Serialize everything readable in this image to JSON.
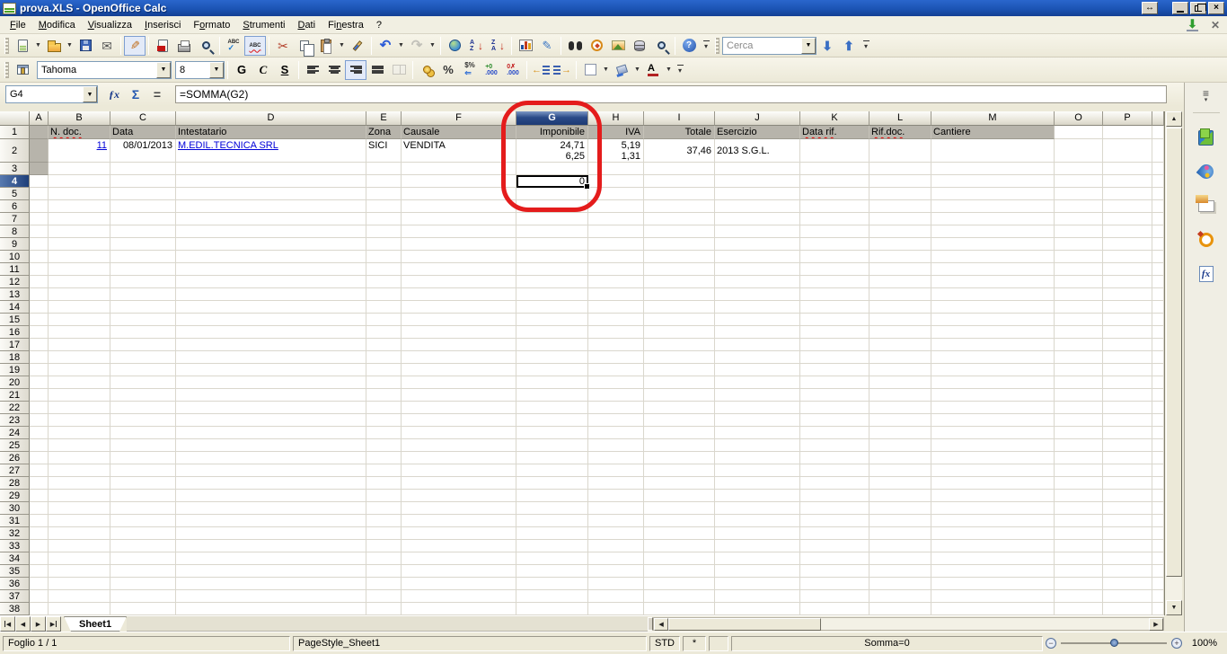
{
  "window": {
    "title": "prova.XLS - OpenOffice Calc"
  },
  "menu": {
    "items": [
      {
        "label": "File",
        "accel": 0
      },
      {
        "label": "Modifica",
        "accel": 0
      },
      {
        "label": "Visualizza",
        "accel": 0
      },
      {
        "label": "Inserisci",
        "accel": 0
      },
      {
        "label": "Formato",
        "accel": 1
      },
      {
        "label": "Strumenti",
        "accel": 0
      },
      {
        "label": "Dati",
        "accel": 0
      },
      {
        "label": "Finestra",
        "accel": 2
      },
      {
        "label": "?",
        "accel": -1
      }
    ]
  },
  "find_toolbar": {
    "search_value": "Cerca"
  },
  "format_toolbar": {
    "font_name": "Tahoma",
    "font_size": "8",
    "bold_label": "G",
    "italic_label": "C",
    "underline_label": "S"
  },
  "formula_bar": {
    "cell_reference": "G4",
    "formula": "=SOMMA(G2)"
  },
  "sheet": {
    "columns": [
      [
        "A",
        21
      ],
      [
        "B",
        69
      ],
      [
        "C",
        73
      ],
      [
        "D",
        212
      ],
      [
        "E",
        39
      ],
      [
        "F",
        128
      ],
      [
        "G",
        80
      ],
      [
        "H",
        62
      ],
      [
        "I",
        79
      ],
      [
        "J",
        95
      ],
      [
        "K",
        77
      ],
      [
        "L",
        69
      ],
      [
        "M",
        137
      ],
      [
        "O",
        54
      ],
      [
        "P",
        55
      ],
      [
        "",
        13
      ]
    ],
    "selected_column": "G",
    "selected_row": 4,
    "num_rows": 38,
    "cells": {
      "B1": {
        "text": "N. doc.",
        "wave": true
      },
      "C1": {
        "text": "Data"
      },
      "D1": {
        "text": "Intestatario"
      },
      "E1": {
        "text": "Zona"
      },
      "F1": {
        "text": "Causale"
      },
      "G1": {
        "text": "Imponibile",
        "align": "right"
      },
      "H1": {
        "text": "IVA",
        "align": "right"
      },
      "I1": {
        "text": "Totale",
        "align": "right"
      },
      "J1": {
        "text": "Esercizio"
      },
      "K1": {
        "text": "Data rif.",
        "wave": true
      },
      "L1": {
        "text": "Rif.doc.",
        "wave": true
      },
      "M1": {
        "text": "Cantiere"
      },
      "B2": {
        "text": "11",
        "align": "right",
        "link": true
      },
      "C2": {
        "text": "08/01/2013",
        "align": "right"
      },
      "D2": {
        "text": "M.EDIL.TECNICA SRL",
        "link": true
      },
      "E2": {
        "text": "SICI"
      },
      "F2": {
        "text": "VENDITA"
      },
      "G2": {
        "lines": [
          "24,71",
          "6,25"
        ],
        "align": "right"
      },
      "H2": {
        "lines": [
          "5,19",
          "1,31"
        ],
        "align": "right"
      },
      "I2": {
        "text": "37,46",
        "align": "right",
        "middle": true
      },
      "J2": {
        "text": "2013 S.G.L.",
        "middle": true
      },
      "G4": {
        "text": "0",
        "align": "right",
        "selected": true
      }
    },
    "gray_cells": [
      "A1",
      "B1",
      "C1",
      "D1",
      "E1",
      "F1",
      "G1",
      "H1",
      "I1",
      "J1",
      "K1",
      "L1",
      "M1",
      "A2",
      "A3"
    ]
  },
  "sheet_tabs": {
    "active": "Sheet1"
  },
  "status_bar": {
    "sheet_info": "Foglio 1 / 1",
    "page_style": "PageStyle_Sheet1",
    "insert_mode": "STD",
    "modified_flag": "*",
    "sum_text": "Somma=0",
    "zoom_level": "100%"
  },
  "annotation": {
    "shape": "ellipse",
    "color": "#e41c1c",
    "target": "column G with selected cell G4"
  }
}
